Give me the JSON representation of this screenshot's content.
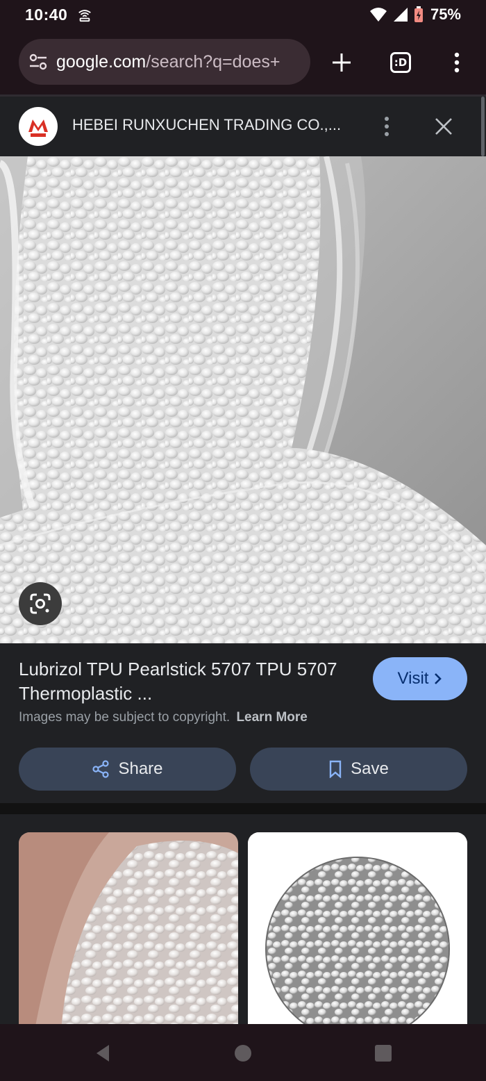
{
  "status_bar": {
    "time": "10:40",
    "battery": "75%",
    "icons": [
      "hotspot-icon",
      "wifi-icon",
      "cell-signal-icon",
      "battery-icon"
    ]
  },
  "browser": {
    "url_host": "google.com",
    "url_path": "/search?q=does+",
    "tab_count": ":D",
    "icons": [
      "site-settings-icon",
      "new-tab-icon",
      "tab-switcher-icon",
      "more-vert-icon"
    ]
  },
  "source": {
    "name": "HEBEI RUNXUCHEN TRADING CO.,...",
    "logo_text": "M"
  },
  "result": {
    "title": "Lubrizol TPU Pearlstick 5707 TPU 5707 Thermoplastic ...",
    "visit_label": "Visit",
    "copyright_text": "Images may be subject to copyright.",
    "learn_more": "Learn More",
    "share_label": "Share",
    "save_label": "Save"
  },
  "colors": {
    "accent_blue": "#8ab4f8",
    "chip_bg": "#394457",
    "toolbar_bg": "#1f141a",
    "panel_bg": "#202124"
  }
}
